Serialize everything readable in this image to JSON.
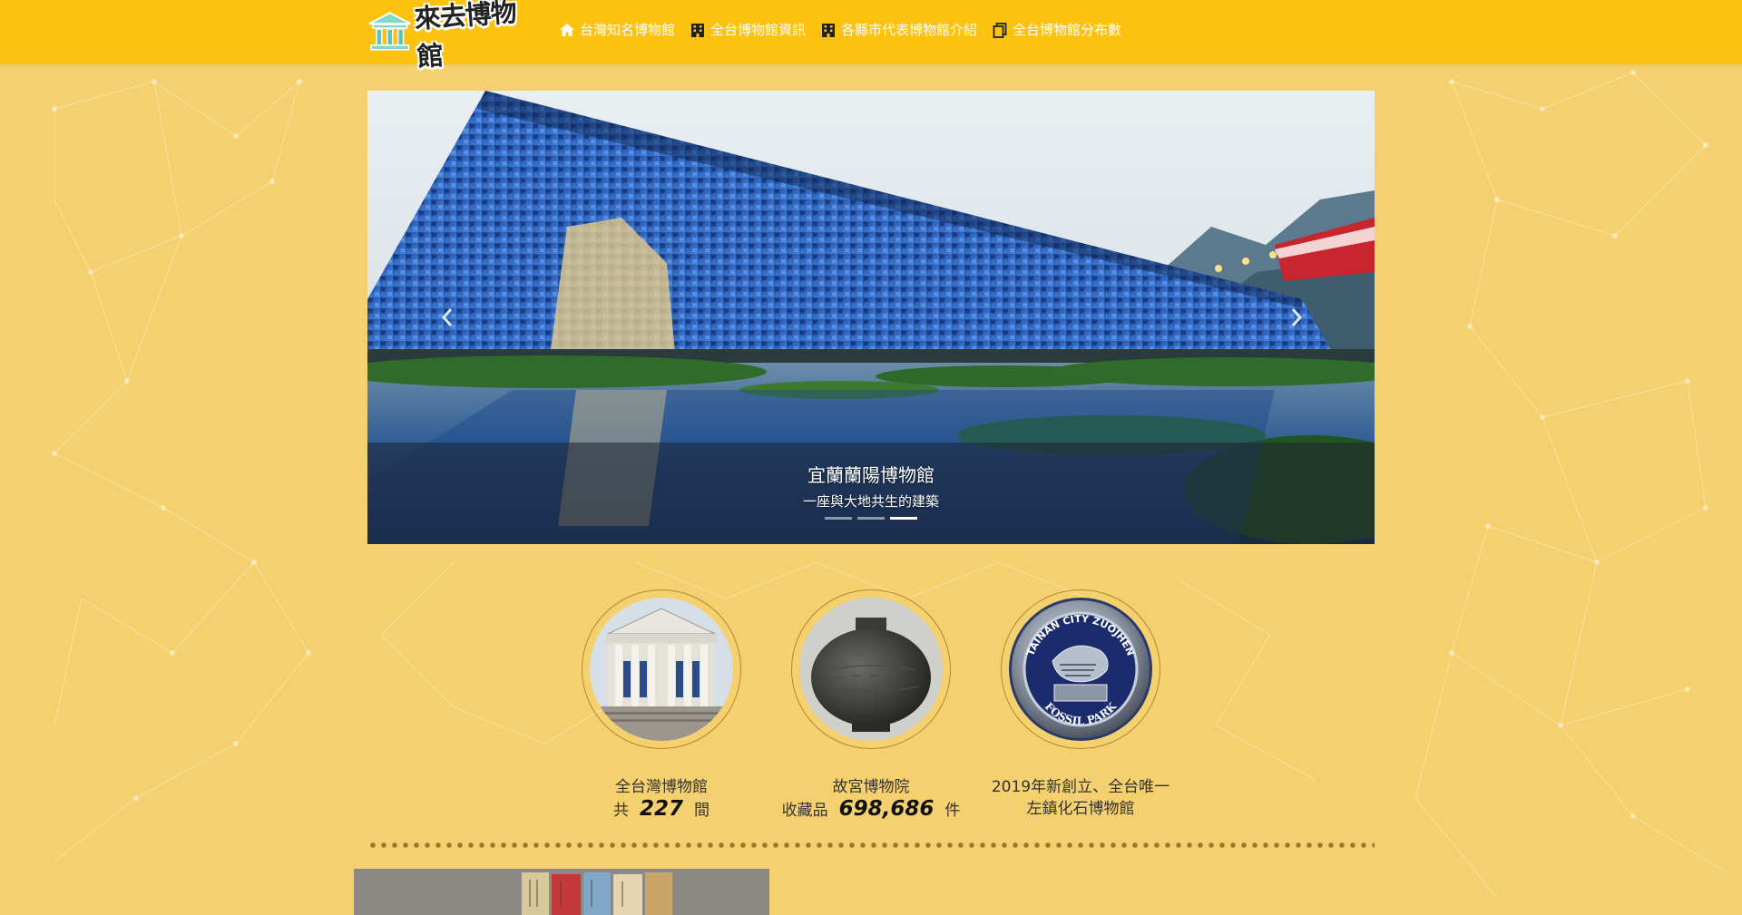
{
  "brand": {
    "logo_text": "來去博物館"
  },
  "nav": {
    "items": [
      {
        "label": "台灣知名博物館",
        "icon": "home-icon"
      },
      {
        "label": "全台博物館資訊",
        "icon": "building-icon"
      },
      {
        "label": "各縣市代表博物館介紹",
        "icon": "building-icon"
      },
      {
        "label": "全台博物館分布數",
        "icon": "copy-icon"
      }
    ]
  },
  "carousel": {
    "title": "宜蘭蘭陽博物館",
    "subtitle": "一座與大地共生的建築",
    "slide_count": 3,
    "active_index": 2
  },
  "stats": [
    {
      "line1": "全台灣博物館",
      "prefix": "共",
      "value": "227",
      "suffix": "間",
      "image": "museum-building"
    },
    {
      "line1": "故宮博物院",
      "prefix": "收藏品",
      "value": "698,686",
      "suffix": "件",
      "image": "bronze-vessel"
    },
    {
      "line1": "2019年新創立、全台唯一",
      "line2": "左鎮化石博物館",
      "image": "fossil-park-coin",
      "coin_top": "TAINAN CITY ZUOJHEN",
      "coin_bottom": "FOSSIL PARK"
    }
  ],
  "colors": {
    "navbar": "#fdc20f",
    "background": "#f5d06e",
    "accent": "#b8862a"
  }
}
